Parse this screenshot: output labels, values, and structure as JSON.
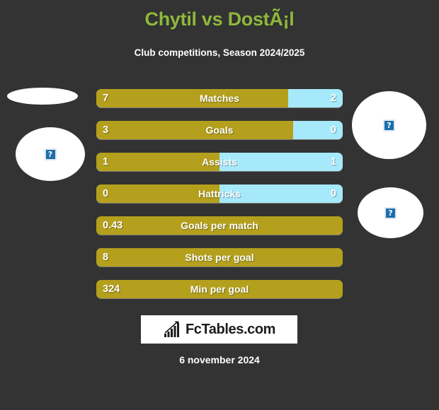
{
  "header": {
    "title": "Chytil vs DostÃ¡l",
    "subtitle": "Club competitions, Season 2024/2025"
  },
  "colors": {
    "background": "#333333",
    "title_green": "#8eb83c",
    "bar_gold": "#b4a01c",
    "bar_blue": "#a6e9fb",
    "text_white": "#ffffff",
    "broken_icon_blue": "#1a6eab"
  },
  "placeholders": [
    {
      "name": "left-top",
      "icon": "broken-image-icon",
      "glyph": "?"
    },
    {
      "name": "left-bottom",
      "icon": "broken-image-icon",
      "glyph": "?"
    },
    {
      "name": "right-top",
      "icon": "broken-image-icon",
      "glyph": "?"
    },
    {
      "name": "right-bottom",
      "icon": "broken-image-icon",
      "glyph": "?"
    }
  ],
  "chart_data": {
    "type": "bar",
    "title": "Chytil vs DostÃ¡l",
    "subtitle": "Club competitions, Season 2024/2025",
    "orientation": "horizontal-diverging",
    "legend": [
      "Chytil",
      "DostÃ¡l"
    ],
    "categories": [
      "Matches",
      "Goals",
      "Assists",
      "Hattricks",
      "Goals per match",
      "Shots per goal",
      "Min per goal"
    ],
    "series": [
      {
        "name": "Chytil",
        "color": "#b4a01c",
        "values": [
          "7",
          "3",
          "1",
          "0",
          "0.43",
          "8",
          "324"
        ]
      },
      {
        "name": "DostÃ¡l",
        "color": "#a6e9fb",
        "values": [
          "2",
          "0",
          "1",
          "0",
          null,
          null,
          null
        ]
      }
    ],
    "rows": [
      {
        "label": "Matches",
        "left_value": "7",
        "right_value": "2",
        "left_pct": 77.8,
        "has_right": true
      },
      {
        "label": "Goals",
        "left_value": "3",
        "right_value": "0",
        "left_pct": 80.0,
        "has_right": true
      },
      {
        "label": "Assists",
        "left_value": "1",
        "right_value": "1",
        "left_pct": 50.0,
        "has_right": true
      },
      {
        "label": "Hattricks",
        "left_value": "0",
        "right_value": "0",
        "left_pct": 50.0,
        "has_right": true
      },
      {
        "label": "Goals per match",
        "left_value": "0.43",
        "right_value": "",
        "left_pct": 100,
        "has_right": false
      },
      {
        "label": "Shots per goal",
        "left_value": "8",
        "right_value": "",
        "left_pct": 100,
        "has_right": false
      },
      {
        "label": "Min per goal",
        "left_value": "324",
        "right_value": "",
        "left_pct": 100,
        "has_right": false
      }
    ]
  },
  "footer": {
    "logo_text": "FcTables.com",
    "logo_icon": "bar-chart-arrow-icon",
    "date": "6 november 2024"
  }
}
